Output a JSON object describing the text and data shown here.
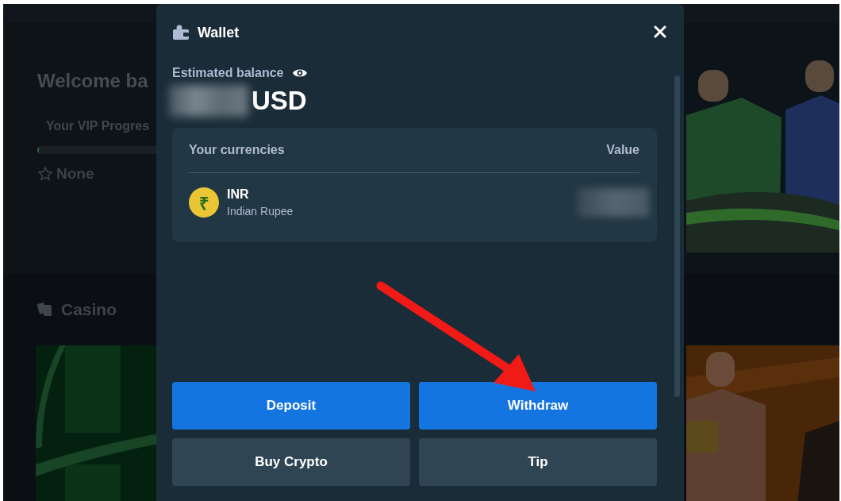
{
  "background": {
    "welcome": "Welcome ba",
    "vip_label": "Your VIP Progres",
    "vip_progress": {
      "level": 0.01
    },
    "vip_tier": "None",
    "section": "Casino"
  },
  "wallet": {
    "title": "Wallet",
    "balance_label": "Estimated balance",
    "currency": "USD",
    "table": {
      "columns": [
        "Your currencies",
        "Value"
      ],
      "rows": [
        {
          "symbol": "₹",
          "code": "INR",
          "name": "Indian Rupee"
        }
      ]
    },
    "buttons": [
      {
        "label": "Deposit",
        "kind": "primary"
      },
      {
        "label": "Withdraw",
        "kind": "primary"
      },
      {
        "label": "Buy Crypto",
        "kind": "secondary"
      },
      {
        "label": "Tip",
        "kind": "secondary"
      }
    ]
  }
}
